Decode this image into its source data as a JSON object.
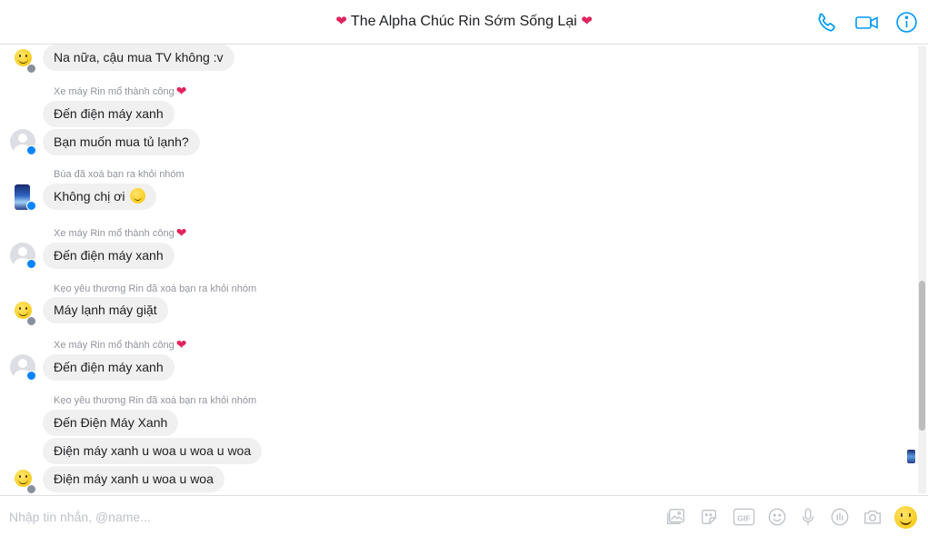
{
  "header": {
    "heart_left": "❤",
    "title": "The Alpha Chúc Rin Sớm Sống Lại",
    "heart_right": "❤",
    "icons": [
      "phone-icon",
      "video-call-icon",
      "info-icon"
    ]
  },
  "messages": [
    {
      "type": "bubble",
      "text": "Na nữa, cậu mua TV không :v"
    },
    {
      "type": "system",
      "text": "Xe máy Rin mổ thành công",
      "heart": "❤"
    },
    {
      "type": "bubble",
      "text": "Đến điện máy xanh"
    },
    {
      "type": "bubble",
      "text": "Bạn muốn mua tủ lạnh?"
    },
    {
      "type": "system",
      "text": "Búa đã xoá bạn ra khỏi nhóm"
    },
    {
      "type": "bubble",
      "text": "Không chị ơi",
      "emoji": "slight-smile-emoji"
    },
    {
      "type": "system",
      "text": "Xe máy Rin mổ thành công",
      "heart": "❤"
    },
    {
      "type": "bubble",
      "text": "Đến điện máy xanh"
    },
    {
      "type": "system",
      "text": "Kẹo yêu thương Rin đã xoá bạn ra khỏi nhóm"
    },
    {
      "type": "bubble",
      "text": "Máy lạnh máy giặt"
    },
    {
      "type": "system",
      "text": "Xe máy Rin mổ thành công",
      "heart": "❤"
    },
    {
      "type": "bubble",
      "text": "Đến điện máy xanh"
    },
    {
      "type": "system",
      "text": "Kẹo yêu thương Rin đã xoá bạn ra khỏi nhóm"
    },
    {
      "type": "bubble",
      "text": "Đến Điện Máy Xanh"
    },
    {
      "type": "bubble",
      "text": "Điện máy xanh u woa u woa u woa"
    },
    {
      "type": "bubble",
      "text": "Điện máy xanh u woa u woa"
    }
  ],
  "avatars": [
    "smiley-avatar",
    "default-profile-avatar",
    "photo-avatar",
    "default-profile-avatar",
    "smiley-avatar",
    "default-profile-avatar",
    "smiley-avatar"
  ],
  "composer": {
    "placeholder": "Nhập tin nhắn, @name...",
    "tools": [
      "image-icon",
      "sticker-icon",
      "gif-icon",
      "emoji-icon",
      "microphone-icon",
      "poll-icon",
      "camera-icon"
    ],
    "like": "like-emoji-button"
  },
  "colors": {
    "accent": "#0084ff",
    "bubble": "#f1f0f0",
    "system_text": "#90949c",
    "heart": "#e0245e"
  }
}
